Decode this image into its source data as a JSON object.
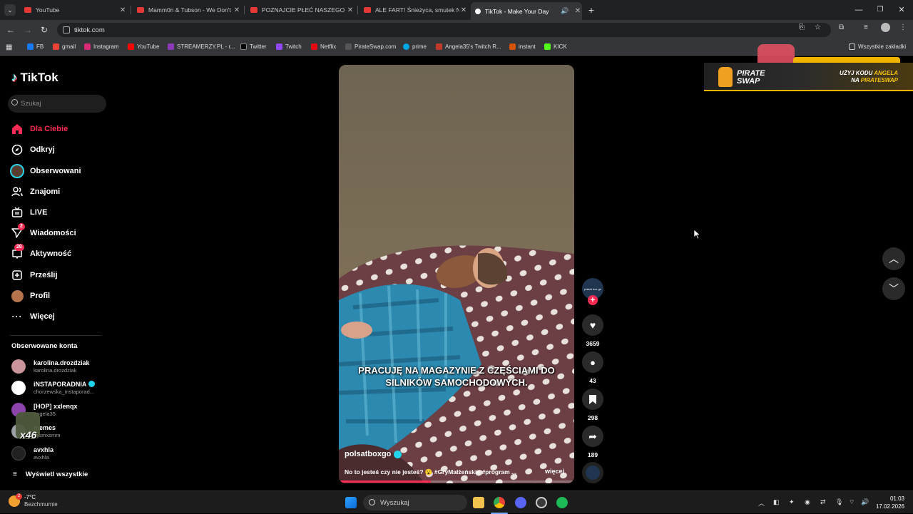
{
  "browser": {
    "tabs": [
      {
        "title": "YouTube",
        "favicon": "youtube-icon"
      },
      {
        "title": "Mamm0n & Tubson - We Don't",
        "favicon": "youtube-icon"
      },
      {
        "title": "POZNAJCIE PŁEĆ NASZEGO DZ",
        "favicon": "youtube-icon"
      },
      {
        "title": "ALE FART! Śnieżyca, smutek Ni",
        "favicon": "youtube-icon"
      },
      {
        "title": "TikTok - Make Your Day",
        "favicon": "tiktok-icon",
        "active": true
      }
    ],
    "url": "tiktok.com",
    "bookmarks": [
      "FB",
      "gmail",
      "Instagram",
      "YouTube",
      "STREAMERZY.PL - r...",
      "Twitter",
      "Twitch",
      "Netflix",
      "PirateSwap.com",
      "prime",
      "Angela35's Twitch R...",
      "instant",
      "KICK"
    ],
    "all_bookmarks": "Wszystkie zakładki"
  },
  "tiktok": {
    "logo": "TikTok",
    "search_placeholder": "Szukaj",
    "nav": [
      {
        "label": "Dla Ciebie",
        "icon": "home-icon",
        "active": true
      },
      {
        "label": "Odkryj",
        "icon": "compass-icon"
      },
      {
        "label": "Obserwowani",
        "icon": "following-avatar-icon"
      },
      {
        "label": "Znajomi",
        "icon": "friends-icon"
      },
      {
        "label": "LIVE",
        "icon": "live-icon"
      },
      {
        "label": "Wiadomości",
        "icon": "messages-icon",
        "badge": "2"
      },
      {
        "label": "Aktywność",
        "icon": "activity-icon",
        "badge": "20"
      },
      {
        "label": "Prześlij",
        "icon": "upload-icon"
      },
      {
        "label": "Profil",
        "icon": "profile-icon"
      },
      {
        "label": "Więcej",
        "icon": "more-icon"
      }
    ],
    "following_title": "Obserwowane konta",
    "following": [
      {
        "name": "karolina.drozdziak",
        "handle": "karolina.drozdziak"
      },
      {
        "name": "iNSTAPORADNIA",
        "handle": "chorzewska_instaporad...",
        "verified": true
      },
      {
        "name": "[HOP] xxlenqx",
        "handle": "angela35"
      },
      {
        "name": "memes",
        "handle": "xssmxsmm"
      },
      {
        "name": "avxhla",
        "handle": "avxhla"
      }
    ],
    "show_all": "Wyświetl wszystkie",
    "overlay_text": "x46"
  },
  "video": {
    "caption": "PRACUJĘ NA MAGAZYNIE Z CZĘŚCIAMI DO SILNIKÓW SAMOCHODOWYCH.",
    "author": "polsatboxgo",
    "description": "No to jesteś czy nie jesteś? 😮 #GryMałżeńskie #program ...",
    "more": "więcej",
    "progress_fraction": 0.39,
    "creator_avatar_text": "polsat box go",
    "likes": "3659",
    "comments": "43",
    "saves": "298",
    "shares": "189"
  },
  "ad": {
    "brand_line1": "PIRATE",
    "brand_line2": "SWAP",
    "promo_line1": "UŻYJ KODU",
    "promo_code": "ANGELA",
    "promo_line2": "NA",
    "promo_site": "PIRATESWAP"
  },
  "taskbar": {
    "temperature": "-7°C",
    "weather": "Bezchmurnie",
    "weather_badge": "2",
    "search": "Wyszukaj",
    "time": "01:03",
    "date": "17.02.2026"
  },
  "colors": {
    "accent": "#fe2c55",
    "verified": "#20d5ec",
    "background": "#000000"
  }
}
